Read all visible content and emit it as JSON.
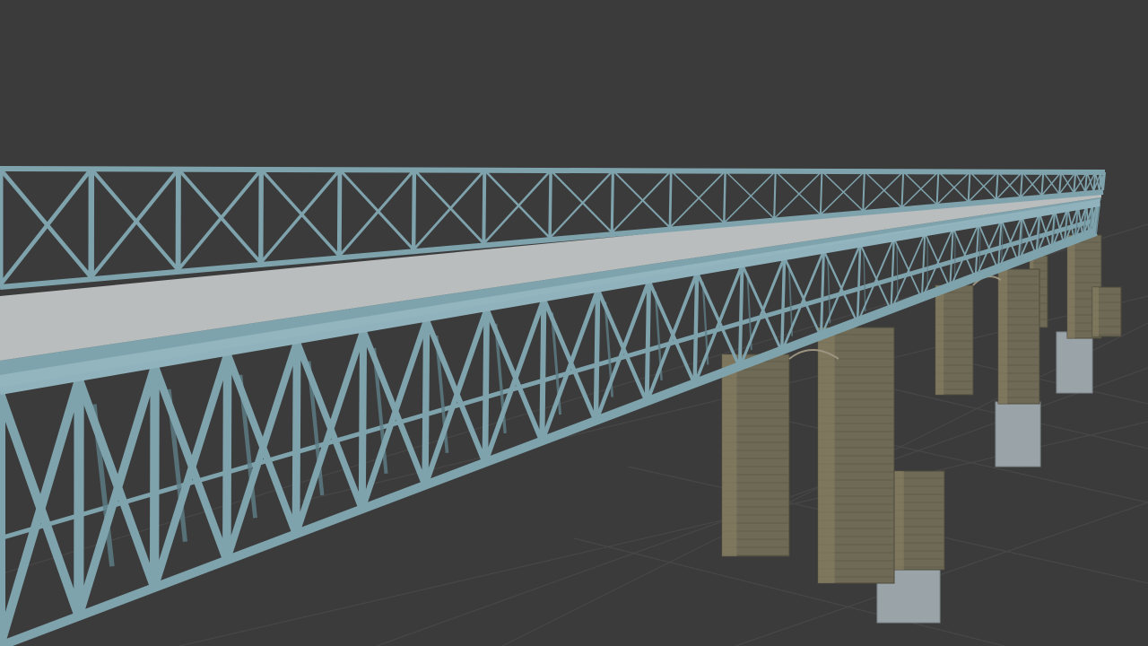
{
  "viewport": {
    "background": "#3b3b3b",
    "grid_color": "#474747"
  },
  "scene": {
    "objects": [
      {
        "name": "steel-truss-bridge",
        "material": "painted-steel",
        "color": "#7fa3ad"
      },
      {
        "name": "bridge-deck",
        "material": "concrete",
        "color": "#b9bdbd"
      },
      {
        "name": "stone-piers",
        "material": "masonry",
        "color": "#6f6a55",
        "count": 5
      },
      {
        "name": "pier-footings",
        "material": "stone-light",
        "color": "#9aa3a8"
      }
    ]
  }
}
